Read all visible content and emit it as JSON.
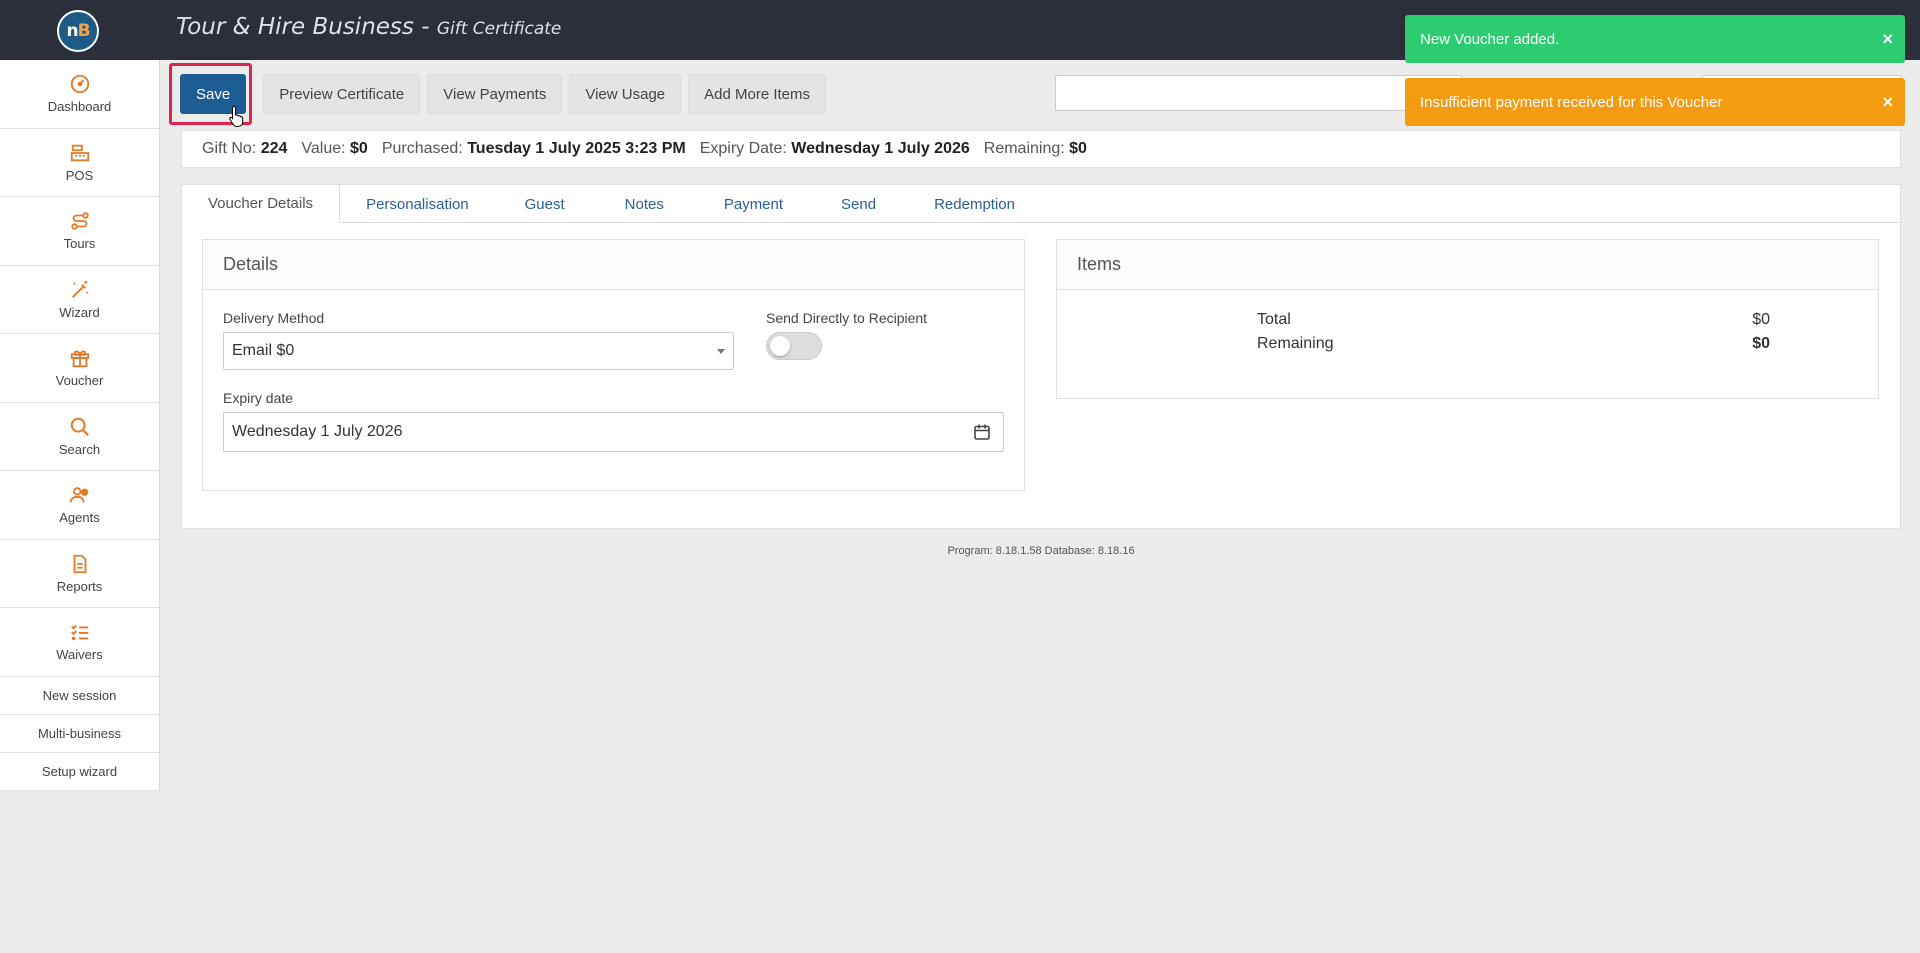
{
  "header": {
    "logo_text_n": "n",
    "logo_text_b": "B",
    "title": "Tour & Hire Business",
    "separator": " - ",
    "subtitle": "Gift Certificate"
  },
  "sidebar": {
    "items": [
      {
        "label": "Dashboard",
        "icon": "gauge-icon"
      },
      {
        "label": "POS",
        "icon": "cash-register-icon"
      },
      {
        "label": "Tours",
        "icon": "route-icon"
      },
      {
        "label": "Wizard",
        "icon": "magic-wand-icon"
      },
      {
        "label": "Voucher",
        "icon": "gift-icon"
      },
      {
        "label": "Search",
        "icon": "search-icon"
      },
      {
        "label": "Agents",
        "icon": "users-icon"
      },
      {
        "label": "Reports",
        "icon": "document-icon"
      },
      {
        "label": "Waivers",
        "icon": "checklist-icon"
      }
    ],
    "links": [
      "New session",
      "Multi-business",
      "Setup wizard"
    ],
    "icon_color": "#e07b2a"
  },
  "toolbar": {
    "save": "Save",
    "preview": "Preview Certificate",
    "payments": "View Payments",
    "usage": "View Usage",
    "add_items": "Add More Items"
  },
  "info": {
    "gift_no_label": "Gift No:",
    "gift_no": "224",
    "value_label": "Value:",
    "value": "$0",
    "purchased_label": "Purchased:",
    "purchased": "Tuesday 1 July 2025 3:23 PM",
    "expiry_label": "Expiry Date:",
    "expiry": "Wednesday 1 July 2026",
    "remaining_label": "Remaining:",
    "remaining": "$0"
  },
  "tabs": [
    "Voucher Details",
    "Personalisation",
    "Guest",
    "Notes",
    "Payment",
    "Send",
    "Redemption"
  ],
  "details": {
    "title": "Details",
    "delivery_label": "Delivery Method",
    "delivery_value": "Email $0",
    "send_direct_label": "Send Directly to Recipient",
    "send_direct_on": false,
    "expiry_label": "Expiry date",
    "expiry_value": "Wednesday 1 July 2026"
  },
  "items": {
    "title": "Items",
    "total_label": "Total",
    "total_value": "$0",
    "remaining_label": "Remaining",
    "remaining_value": "$0"
  },
  "footer": "Program: 8.18.1.58 Database: 8.18.16",
  "toasts": {
    "success": "New Voucher added.",
    "warning": "Insufficient payment received for this Voucher",
    "close": "×"
  }
}
